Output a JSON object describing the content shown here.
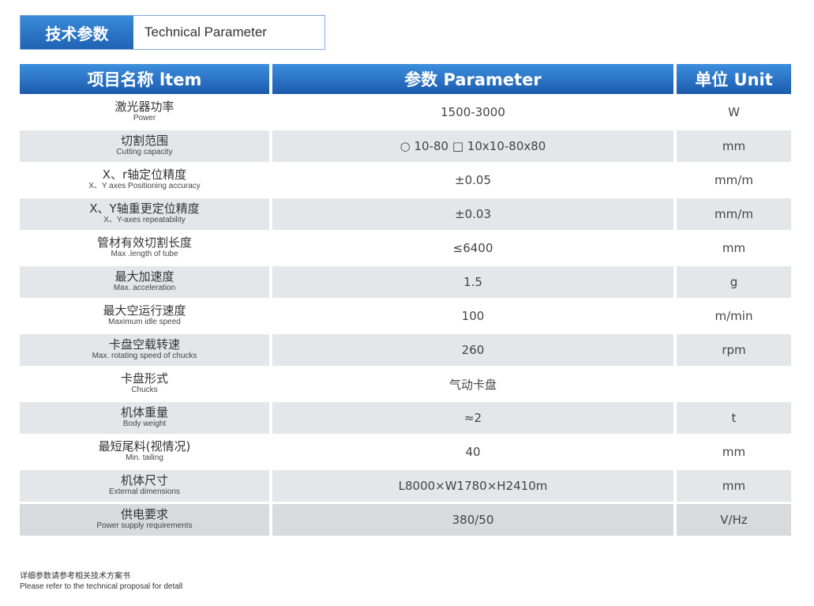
{
  "title": {
    "cn": "技术参数",
    "en": "Technical Parameter"
  },
  "table": {
    "headers": {
      "item": "项目名称 ltem",
      "parameter": "参数 Parameter",
      "unit": "单位 Unit"
    },
    "rows": [
      {
        "cn": "激光器功率",
        "en": "Power",
        "value": "1500-3000",
        "unit": "W"
      },
      {
        "cn": "切割范围",
        "en": "Cutting capacity",
        "value": "○ 10-80 □ 10x10-80x80",
        "unit": "mm"
      },
      {
        "cn": "X、r轴定位精度",
        "en": "X、Y axes Positioning accuracy",
        "value": "±0.05",
        "unit": "mm/m"
      },
      {
        "cn": "X、Y轴重更定位精度",
        "en": "X、Y-axes repeatability",
        "value": "±0.03",
        "unit": "mm/m"
      },
      {
        "cn": "管材有效切割长度",
        "en": "Max .length of tube",
        "value": "≤6400",
        "unit": "mm"
      },
      {
        "cn": "最大加速度",
        "en": "Max. acceleration",
        "value": "1.5",
        "unit": "g"
      },
      {
        "cn": "最大空运行速度",
        "en": "Maximum idle speed",
        "value": "100",
        "unit": "m/min"
      },
      {
        "cn": "卡盘空载转速",
        "en": "Max. rotating speed of chucks",
        "value": "260",
        "unit": "rpm"
      },
      {
        "cn": "卡盘形式",
        "en": "Chucks",
        "value": "气动卡盘",
        "unit": ""
      },
      {
        "cn": "机体重量",
        "en": "Body weight",
        "value": "≈2",
        "unit": "t"
      },
      {
        "cn": "最短尾料(视情况)",
        "en": "Min. tailing",
        "value": "40",
        "unit": "mm"
      },
      {
        "cn": "机体尺寸",
        "en": "External dimensions",
        "value": "L8000×W1780×H2410m",
        "unit": "mm"
      },
      {
        "cn": "供电要求",
        "en": "Power supply requirements",
        "value": "380/50",
        "unit": "V/Hz"
      }
    ]
  },
  "note": {
    "cn": "详细参数请参考相关技术方案书",
    "en": "Please refer to the technical proposal for detall"
  }
}
